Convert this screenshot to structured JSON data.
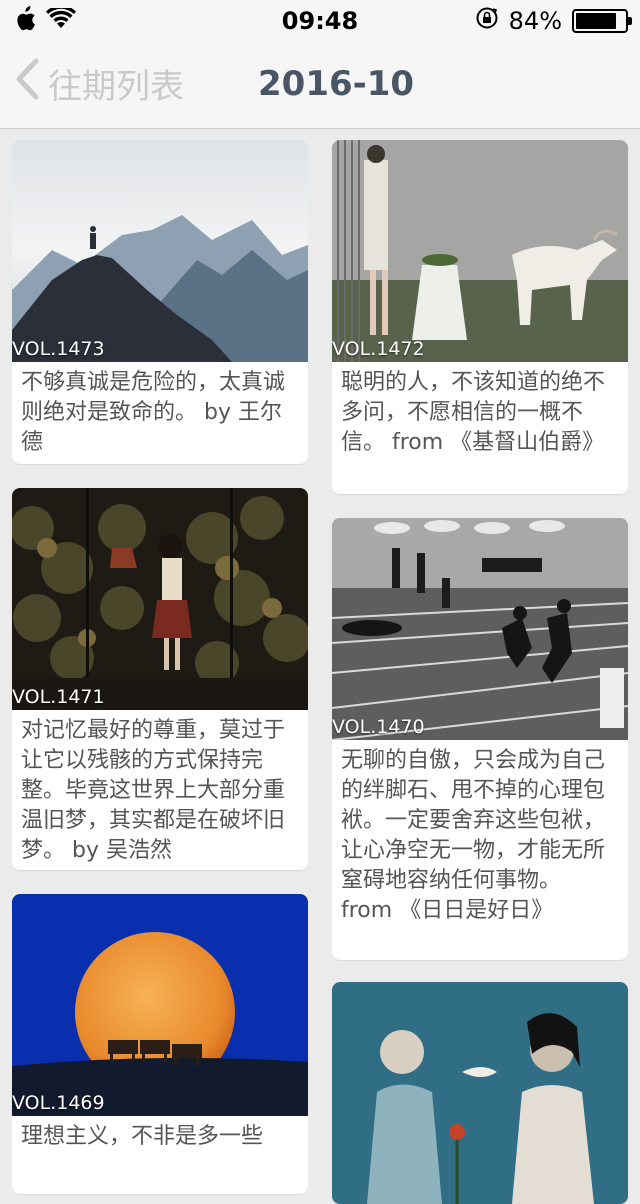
{
  "status_bar": {
    "time": "09:48",
    "battery": "84%",
    "battery_level": 0.84
  },
  "nav": {
    "back_label": "往期列表",
    "title": "2016-10"
  },
  "cards": [
    {
      "vol": "VOL.1473",
      "text": "不够真诚是危险的，太真诚则绝对是致命的。 by 王尔德"
    },
    {
      "vol": "VOL.1472",
      "text": "聪明的人，不该知道的绝不多问，不愿相信的一概不信。 from 《基督山伯爵》"
    },
    {
      "vol": "VOL.1471",
      "text": "对记忆最好的尊重，莫过于让它以残骸的方式保持完整。毕竟这世界上大部分重温旧梦，其实都是在破坏旧梦。 by 吴浩然"
    },
    {
      "vol": "VOL.1470",
      "text": "无聊的自傲，只会成为自己的绊脚石、甩不掉的心理包袱。一定要舍弃这些包袱，让心净空无一物，才能无所窒碍地容纳任何事物。 from 《日日是好日》"
    },
    {
      "vol": "VOL.1469",
      "text": "理想主义，不非是多一些"
    },
    {
      "vol": "",
      "text": ""
    }
  ]
}
